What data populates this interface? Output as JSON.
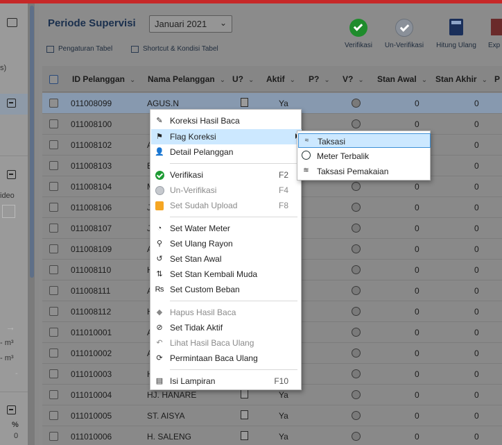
{
  "header": {
    "title": "Periode Supervisi",
    "period_value": "Januari 2021",
    "pengaturan_tabel": "Pengaturan Tabel",
    "shortcut_kondisi": "Shortcut & Kondisi Tabel"
  },
  "toolbar": {
    "verifikasi": "Verifikasi",
    "un_verifikasi": "Un-Verifikasi",
    "hitung_ulang": "Hitung Ulang",
    "export": "Exp"
  },
  "left_panel": {
    "s_label": "s)",
    "video_label": "ideo",
    "m3_a": "- m³",
    "m3_b": "- m³",
    "dash": "-",
    "percent": "%",
    "zero": "0"
  },
  "table": {
    "columns": [
      "ID Pelanggan",
      "Nama Pelanggan",
      "U?",
      "Aktif",
      "P?",
      "V?",
      "Stan Awal",
      "Stan Akhir",
      "P"
    ],
    "rows": [
      {
        "id": "011008099",
        "nama": "AGUS.N",
        "aktif": "Ya",
        "awal": "0",
        "akhir": "0"
      },
      {
        "id": "011008100",
        "nama": "",
        "aktif": "",
        "awal": "0",
        "akhir": "0"
      },
      {
        "id": "011008102",
        "nama": "A",
        "aktif": "",
        "awal": "",
        "akhir": "0"
      },
      {
        "id": "011008103",
        "nama": "B",
        "aktif": "",
        "awal": "",
        "akhir": "0"
      },
      {
        "id": "011008104",
        "nama": "M",
        "aktif": "",
        "awal": "0",
        "akhir": "0"
      },
      {
        "id": "011008106",
        "nama": "J",
        "aktif": "",
        "awal": "0",
        "akhir": "0"
      },
      {
        "id": "011008107",
        "nama": "J",
        "aktif": "",
        "awal": "0",
        "akhir": "0"
      },
      {
        "id": "011008109",
        "nama": "A",
        "aktif": "",
        "awal": "0",
        "akhir": "0"
      },
      {
        "id": "011008110",
        "nama": "H",
        "aktif": "",
        "awal": "0",
        "akhir": "0"
      },
      {
        "id": "011008111",
        "nama": "A",
        "aktif": "",
        "awal": "0",
        "akhir": "0"
      },
      {
        "id": "011008112",
        "nama": "H",
        "aktif": "",
        "awal": "0",
        "akhir": "0"
      },
      {
        "id": "011010001",
        "nama": "A",
        "aktif": "",
        "awal": "0",
        "akhir": "0"
      },
      {
        "id": "011010002",
        "nama": "A",
        "aktif": "",
        "awal": "0",
        "akhir": "0"
      },
      {
        "id": "011010003",
        "nama": "H",
        "aktif": "",
        "awal": "0",
        "akhir": "0"
      },
      {
        "id": "011010004",
        "nama": "HJ. HANARE",
        "aktif": "Ya",
        "awal": "0",
        "akhir": "0"
      },
      {
        "id": "011010005",
        "nama": "ST. AISYA",
        "aktif": "Ya",
        "awal": "0",
        "akhir": "0"
      },
      {
        "id": "011010006",
        "nama": "H. SALENG",
        "aktif": "Ya",
        "awal": "0",
        "akhir": "0"
      }
    ]
  },
  "context_menu": {
    "koreksi_hasil_baca": "Koreksi Hasil Baca",
    "flag_koreksi": "Flag Koreksi",
    "detail_pelanggan": "Detail Pelanggan",
    "verifikasi": "Verifikasi",
    "verifikasi_sc": "F2",
    "un_verifikasi": "Un-Verifikasi",
    "un_verifikasi_sc": "F4",
    "set_sudah_upload": "Set Sudah Upload",
    "set_sudah_upload_sc": "F8",
    "set_water_meter": "Set Water Meter",
    "set_ulang_rayon": "Set Ulang Rayon",
    "set_stan_awal": "Set Stan Awal",
    "set_stan_kembali_muda": "Set Stan Kembali Muda",
    "set_custom_beban": "Set Custom Beban",
    "hapus_hasil_baca": "Hapus Hasil Baca",
    "set_tidak_aktif": "Set Tidak Aktif",
    "lihat_hasil_baca_ulang": "Lihat Hasil Baca Ulang",
    "permintaan_baca_ulang": "Permintaan Baca Ulang",
    "isi_lampiran": "Isi Lampiran",
    "isi_lampiran_sc": "F10"
  },
  "submenu": {
    "taksasi": "Taksasi",
    "meter_terbalik": "Meter Terbalik",
    "taksasi_pemakaian": "Taksasi Pemakaian"
  }
}
